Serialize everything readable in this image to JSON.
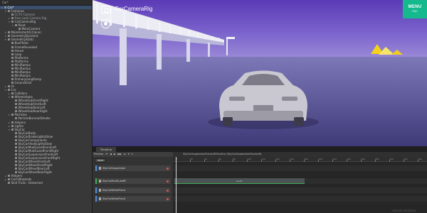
{
  "hierarchy": {
    "header": "Car*",
    "items": [
      {
        "label": "Car*",
        "depth": 0,
        "arrow": "▾",
        "sel": true
      },
      {
        "label": "Cameras",
        "depth": 1,
        "arrow": "▾"
      },
      {
        "label": "CCTV Camera",
        "depth": 2,
        "arrow": "",
        "dim": true
      },
      {
        "label": "Free Look Camera Rig",
        "depth": 2,
        "arrow": "▸",
        "dim": true
      },
      {
        "label": "CarCameraRig",
        "depth": 2,
        "arrow": "▾"
      },
      {
        "label": "Pivot",
        "depth": 3,
        "arrow": "▾"
      },
      {
        "label": "MainCamera",
        "depth": 4,
        "arrow": ""
      },
      {
        "label": "MainHinter01(Clone)",
        "depth": 1,
        "arrow": "▸"
      },
      {
        "label": "GeometryDynamic",
        "depth": 1,
        "arrow": "▸"
      },
      {
        "label": "GeometryStatic",
        "depth": 1,
        "arrow": "▾"
      },
      {
        "label": "BoxPhoto",
        "depth": 2,
        "arrow": ""
      },
      {
        "label": "FrameRevealed",
        "depth": 2,
        "arrow": ""
      },
      {
        "label": "House",
        "depth": 2,
        "arrow": ""
      },
      {
        "label": "Loop",
        "depth": 2,
        "arrow": ""
      },
      {
        "label": "Platforms",
        "depth": 2,
        "arrow": ""
      },
      {
        "label": "Platforms",
        "depth": 2,
        "arrow": ""
      },
      {
        "label": "MiniRamps",
        "depth": 2,
        "arrow": ""
      },
      {
        "label": "MiniRamps",
        "depth": 2,
        "arrow": ""
      },
      {
        "label": "MiniRamps",
        "depth": 2,
        "arrow": ""
      },
      {
        "label": "MiniRamps",
        "depth": 2,
        "arrow": ""
      },
      {
        "label": "PrimaryLongRamp",
        "depth": 2,
        "arrow": ""
      },
      {
        "label": "GroundGrid",
        "depth": 2,
        "arrow": ""
      },
      {
        "label": "UI",
        "depth": 1,
        "arrow": "▸"
      },
      {
        "label": "Car",
        "depth": 1,
        "arrow": "▾"
      },
      {
        "label": "Colliders",
        "depth": 2,
        "arrow": "▸"
      },
      {
        "label": "WheelsHubs",
        "depth": 2,
        "arrow": "▾"
      },
      {
        "label": "WheelHubFrontRight",
        "depth": 3,
        "arrow": ""
      },
      {
        "label": "WheelHubFrontLeft",
        "depth": 3,
        "arrow": ""
      },
      {
        "label": "WheelHubRearLeft",
        "depth": 3,
        "arrow": ""
      },
      {
        "label": "WheelHubRearRight",
        "depth": 3,
        "arrow": ""
      },
      {
        "label": "Particles",
        "depth": 2,
        "arrow": "▾"
      },
      {
        "label": "ParticleBurnoutSmoke",
        "depth": 3,
        "arrow": ""
      },
      {
        "label": "Helpers",
        "depth": 2,
        "arrow": "▸"
      },
      {
        "label": "Lights",
        "depth": 2,
        "arrow": "▸"
      },
      {
        "label": "SkyCar",
        "depth": 2,
        "arrow": "▾"
      },
      {
        "label": "SkyCarBody",
        "depth": 3,
        "arrow": ""
      },
      {
        "label": "SkyCarBrakeLightsGlow",
        "depth": 3,
        "arrow": ""
      },
      {
        "label": "SkyCarComponents",
        "depth": 3,
        "arrow": ""
      },
      {
        "label": "SkyCarHeadLightsGlow",
        "depth": 3,
        "arrow": ""
      },
      {
        "label": "SkyCarMudGuardFrontLeft",
        "depth": 3,
        "arrow": ""
      },
      {
        "label": "SkyCarMudGuardFrontRight",
        "depth": 3,
        "arrow": ""
      },
      {
        "label": "SkyCarSuspensionFrontLeft",
        "depth": 3,
        "arrow": ""
      },
      {
        "label": "SkyCarSuspensionFrontRight",
        "depth": 3,
        "arrow": ""
      },
      {
        "label": "SkyCarWheelFrontLeft",
        "depth": 3,
        "arrow": ""
      },
      {
        "label": "SkyCarWheelFrontRight",
        "depth": 3,
        "arrow": ""
      },
      {
        "label": "SkyCarWheelRearLeft",
        "depth": 3,
        "arrow": ""
      },
      {
        "label": "SkyCarWheelRearRight",
        "depth": 3,
        "arrow": ""
      },
      {
        "label": "Helpers",
        "depth": 1,
        "arrow": "▸"
      },
      {
        "label": "CarCWaluteds",
        "depth": 1,
        "arrow": "▸"
      },
      {
        "label": "Skid Trails - Detached",
        "depth": 1,
        "arrow": ""
      }
    ]
  },
  "game": {
    "camera_title": "CarCameraRig",
    "menu_label": "MENU",
    "menu_sub": "ESC"
  },
  "timeline": {
    "tab": "Timeline",
    "toolbar": [
      "Preview",
      "⏮",
      "◀",
      "▶",
      "▶▶",
      "⏭",
      "0",
      "▾"
    ],
    "add_label": "Add▾",
    "clip_name": "SkyCarSuspensionFrontLeftTimeline (SkyCarSuspensionFrontLeft)",
    "ruler": [
      "0",
      "20",
      "40",
      "60",
      "80",
      "100",
      "120",
      "140",
      "160",
      "180",
      "200",
      "220",
      "240",
      "260",
      "280",
      "300",
      "320",
      "340"
    ],
    "tracks": [
      {
        "label": "SkyCarSuspension",
        "green": false
      },
      {
        "label": "SkyCarMudGuardR",
        "green": true
      },
      {
        "label": "SkyCarWheelFront",
        "green": false
      },
      {
        "label": "SkyCarWheelFront",
        "green": false
      }
    ],
    "clip_label": "Audio",
    "watermark": "Activate Windows"
  }
}
